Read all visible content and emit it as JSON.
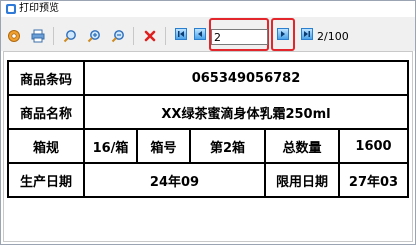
{
  "window": {
    "title": "打印预览"
  },
  "toolbar": {
    "icons": [
      "settings-icon",
      "print-icon",
      "zoom-fit-icon",
      "zoom-in-icon",
      "zoom-out-icon",
      "close-icon",
      "first-page-icon",
      "previous-page-icon",
      "next-page-icon",
      "last-page-icon"
    ],
    "page_input_value": "2",
    "page_count": "2/100",
    "highlight_color": "#e3262b"
  },
  "label": {
    "rows": [
      {
        "cells": [
          "商品条码",
          "065349056782"
        ]
      },
      {
        "cells": [
          "商品名称",
          "XX绿茶蜜滴身体乳霜250ml"
        ]
      },
      {
        "cells": [
          "箱规",
          "16/箱",
          "箱号",
          "第2箱",
          "总数量",
          "1600"
        ]
      },
      {
        "cells": [
          "生产日期",
          "24年09",
          "限用日期",
          "27年03"
        ]
      }
    ]
  }
}
